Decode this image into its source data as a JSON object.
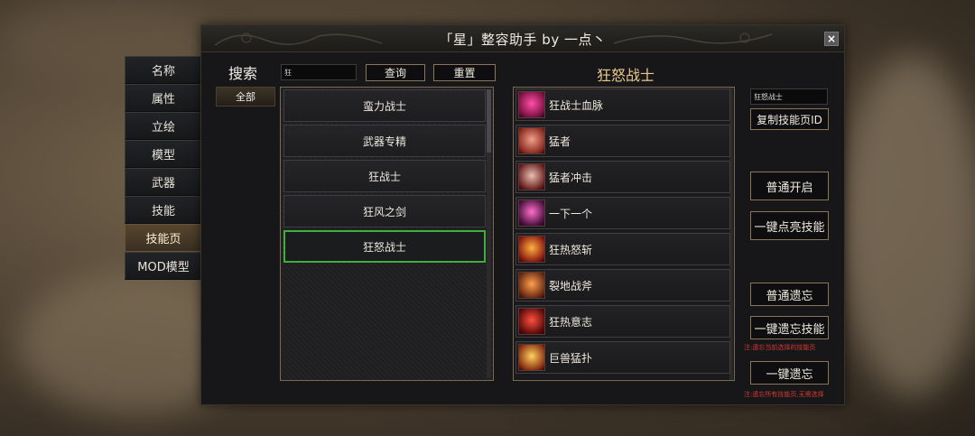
{
  "window": {
    "title": "「星」整容助手    by 一点丶",
    "close_label": "×"
  },
  "tabs": [
    {
      "label": "名称",
      "name": "tab-name"
    },
    {
      "label": "属性",
      "name": "tab-attributes"
    },
    {
      "label": "立绘",
      "name": "tab-portrait"
    },
    {
      "label": "模型",
      "name": "tab-model"
    },
    {
      "label": "武器",
      "name": "tab-weapon"
    },
    {
      "label": "技能",
      "name": "tab-skill"
    },
    {
      "label": "技能页",
      "name": "tab-skill-page",
      "active": true
    },
    {
      "label": "MOD模型",
      "name": "tab-mod-model"
    }
  ],
  "search": {
    "title": "搜索",
    "category_all": "全部",
    "input_value": "狂",
    "query_label": "查询",
    "reset_label": "重置"
  },
  "list": {
    "items": [
      {
        "label": "蛮力战士"
      },
      {
        "label": "武器专精"
      },
      {
        "label": "狂战士"
      },
      {
        "label": "狂风之剑"
      },
      {
        "label": "狂怒战士",
        "selected": true
      }
    ]
  },
  "skills": {
    "heading": "狂怒战士",
    "items": [
      {
        "name": "狂战士血脉",
        "icon": "blood-burst-icon",
        "colors": [
          "#ff4fa8",
          "#7a1040"
        ]
      },
      {
        "name": "猛者",
        "icon": "muscle-man-icon",
        "colors": [
          "#f0a08a",
          "#8a2a20"
        ]
      },
      {
        "name": "猛者冲击",
        "icon": "warrior-charge-icon",
        "colors": [
          "#e8c0b0",
          "#6a2020"
        ]
      },
      {
        "name": "一下一个",
        "icon": "slash-icon",
        "colors": [
          "#ff6fc8",
          "#4a1040"
        ]
      },
      {
        "name": "狂热怒斩",
        "icon": "fire-slash-icon",
        "colors": [
          "#ffb040",
          "#8a1a10"
        ]
      },
      {
        "name": "裂地战斧",
        "icon": "ground-axe-icon",
        "colors": [
          "#ffa050",
          "#6a2a10"
        ]
      },
      {
        "name": "狂热意志",
        "icon": "rage-will-icon",
        "colors": [
          "#ff5040",
          "#5a0a0a"
        ]
      },
      {
        "name": "巨兽猛扑",
        "icon": "beast-pounce-icon",
        "colors": [
          "#ffd060",
          "#8a3010"
        ]
      }
    ]
  },
  "right": {
    "page_id_value": "狂怒战士",
    "copy_id_label": "复制技能页ID",
    "normal_enable_label": "普通开启",
    "one_click_light_label": "一键点亮技能",
    "normal_forget_label": "普通遗忘",
    "one_click_forget_label": "一键遗忘技能",
    "note1": "注:遗忘当前选择的技能页",
    "one_click_forget_all_label": "一键遗忘",
    "note2": "注:遗忘所有技能页,无需选择"
  },
  "colors": {
    "accent_gold": "#8a7556",
    "selection_green": "#3fae3f",
    "note_red": "#d23a32"
  }
}
